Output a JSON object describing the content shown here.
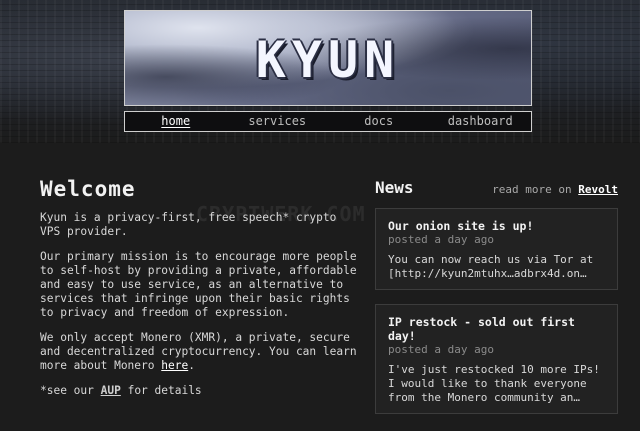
{
  "logo": {
    "text": "KYUN"
  },
  "nav": {
    "items": [
      {
        "label": "home",
        "active": true
      },
      {
        "label": "services",
        "active": false
      },
      {
        "label": "docs",
        "active": false
      },
      {
        "label": "dashboard",
        "active": false
      }
    ]
  },
  "welcome": {
    "heading": "Welcome",
    "p1": "Kyun is a privacy-first, free speech* crypto VPS provider.",
    "p2": "Our primary mission is to encourage more people to self-host by providing a private, affordable and easy to use service, as an alternative to services that infringe upon their basic rights to privacy and freedom of expression.",
    "p3_prefix": "We only accept Monero (XMR), a private, secure and decentralized cryptocurrency. You can learn more about Monero ",
    "p3_link": "here",
    "p3_suffix": ".",
    "footnote_prefix": "*see our ",
    "footnote_link": "AUP",
    "footnote_suffix": " for details"
  },
  "news": {
    "heading": "News",
    "readmore_prefix": "read more on ",
    "readmore_link": "Revolt",
    "posts": [
      {
        "title": "Our onion site is up!",
        "meta": "posted a day ago",
        "body": "You can now reach us via Tor at [http://kyun2mtuhx…adbrx4d.on…"
      },
      {
        "title": "IP restock - sold out first day!",
        "meta": "posted a day ago",
        "body": "I've just restocked 10 more IPs! I would like to thank everyone from the Monero community an…"
      }
    ]
  },
  "watermark": "CRYPTWERK.COM"
}
